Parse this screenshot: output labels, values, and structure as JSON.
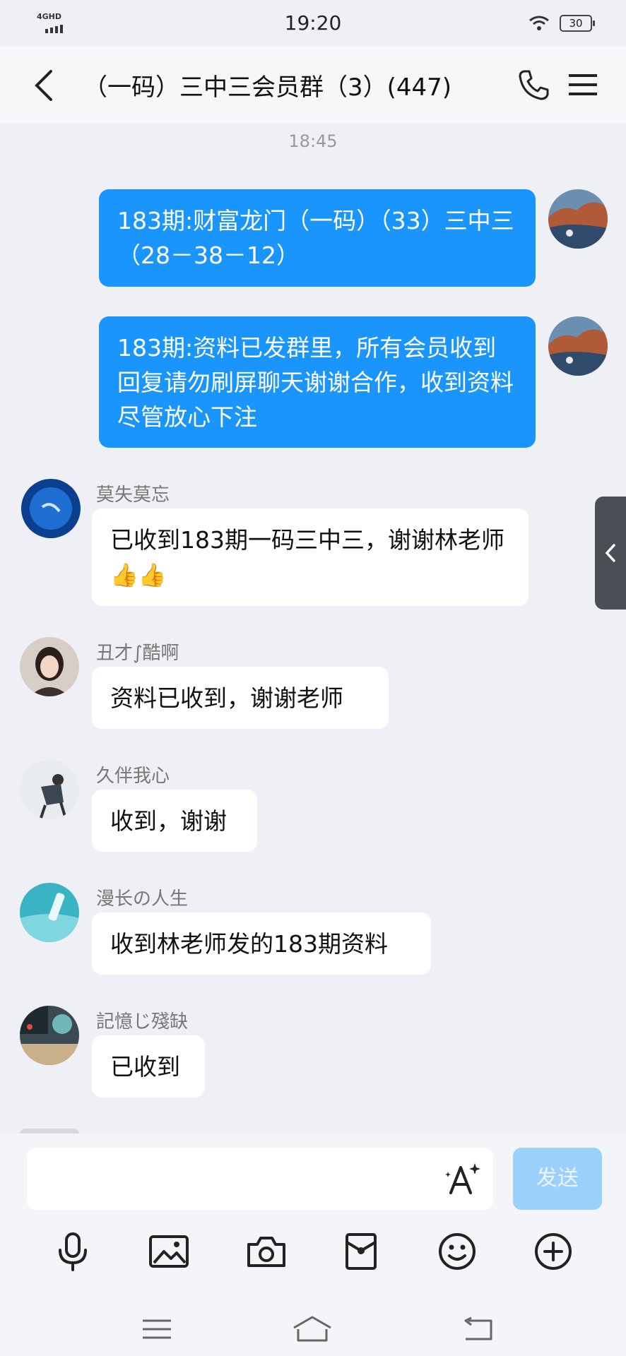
{
  "status_bar": {
    "network": "4GHD",
    "time": "19:20",
    "battery": "30"
  },
  "header": {
    "title": "（一码）三中三会员群（3）(447)"
  },
  "chat": {
    "timestamp": "18:45",
    "outgoing": [
      {
        "text": "183期:财富龙门（一码）（33）三中三（28－38－12）"
      },
      {
        "text": "183期:资料已发群里，所有会员收到回复请勿刷屏聊天谢谢合作，收到资料尽管放心下注"
      }
    ],
    "incoming": [
      {
        "sender": "莫失莫忘",
        "text": "已收到183期一码三中三，谢谢林老师",
        "emoji": "👍👍"
      },
      {
        "sender": "丑才∫酷啊",
        "text": "资料已收到，谢谢老师"
      },
      {
        "sender": "久伴我心",
        "text": "收到，谢谢"
      },
      {
        "sender": "漫长の人生",
        "text": "收到林老师发的183期资料"
      },
      {
        "sender": "記憶じ殘缺",
        "text": "已收到"
      }
    ]
  },
  "composer": {
    "placeholder": "",
    "send_label": "发送"
  },
  "icons": {
    "back": "chevron-left-icon",
    "call": "phone-icon",
    "menu": "hamburger-icon",
    "side_tab": "chevron-left-icon",
    "font": "font-style-icon",
    "toolbar": [
      "microphone-icon",
      "image-icon",
      "camera-icon",
      "red-packet-icon",
      "smiley-icon",
      "plus-circle-icon"
    ],
    "nav": [
      "menu-icon",
      "home-icon",
      "back-icon"
    ]
  },
  "colors": {
    "outgoing_bubble": "#1a95fc",
    "incoming_bubble": "#ffffff",
    "background": "#eef0f5",
    "send_button": "#9bd0fb"
  }
}
